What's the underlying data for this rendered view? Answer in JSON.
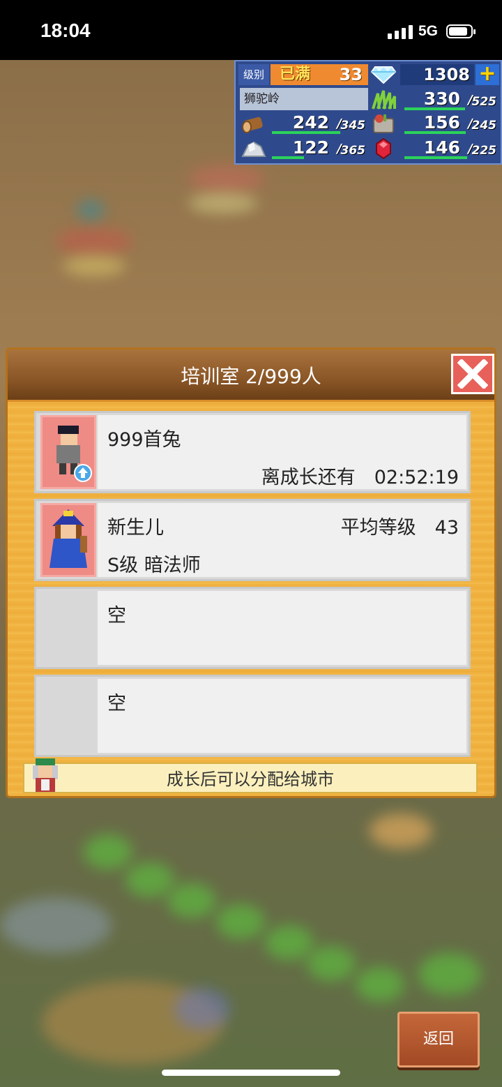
{
  "status_bar": {
    "time": "18:04",
    "network": "5G"
  },
  "hud": {
    "level_label": "级别",
    "level_max_label": "已满",
    "level": "33",
    "gems": "1308",
    "add_label": "+",
    "town_name": "狮驼岭",
    "separator": "/",
    "resources": [
      {
        "icon": "wood-log-icon",
        "current": "242",
        "max": "345",
        "fill": 0.7
      },
      {
        "icon": "grass-icon",
        "current": "330",
        "max": "525",
        "fill": 0.63
      },
      {
        "icon": "food-bag-icon",
        "current": "156",
        "max": "245",
        "fill": 0.64
      },
      {
        "icon": "ore-rock-icon",
        "current": "122",
        "max": "365",
        "fill": 0.33
      },
      {
        "icon": "red-gem-icon",
        "current": "146",
        "max": "225",
        "fill": 0.65
      }
    ]
  },
  "dialog": {
    "title": "培训室 2/999人",
    "close_label": "",
    "rows": [
      {
        "name": "999首兔",
        "right_top": "",
        "sub_left": "",
        "sub_right": "离成长还有　02:52:19",
        "filled": true
      },
      {
        "name": "新生儿",
        "right_top": "平均等级　43",
        "sub_left": "S级 暗法师",
        "sub_right": "",
        "filled": true
      },
      {
        "name": "空",
        "right_top": "",
        "sub_left": "",
        "sub_right": "",
        "filled": false
      },
      {
        "name": "空",
        "right_top": "",
        "sub_left": "",
        "sub_right": "",
        "filled": false
      }
    ],
    "footer_hint": "成长后可以分配给城市"
  },
  "back_label": "返回",
  "colors": {
    "dialog_bg": "#f1b442",
    "titlebar": "#8a5626",
    "hud_bg": "#2f4a8c",
    "close_bg": "#e8605a",
    "portrait_bg": "#ee8b85"
  }
}
